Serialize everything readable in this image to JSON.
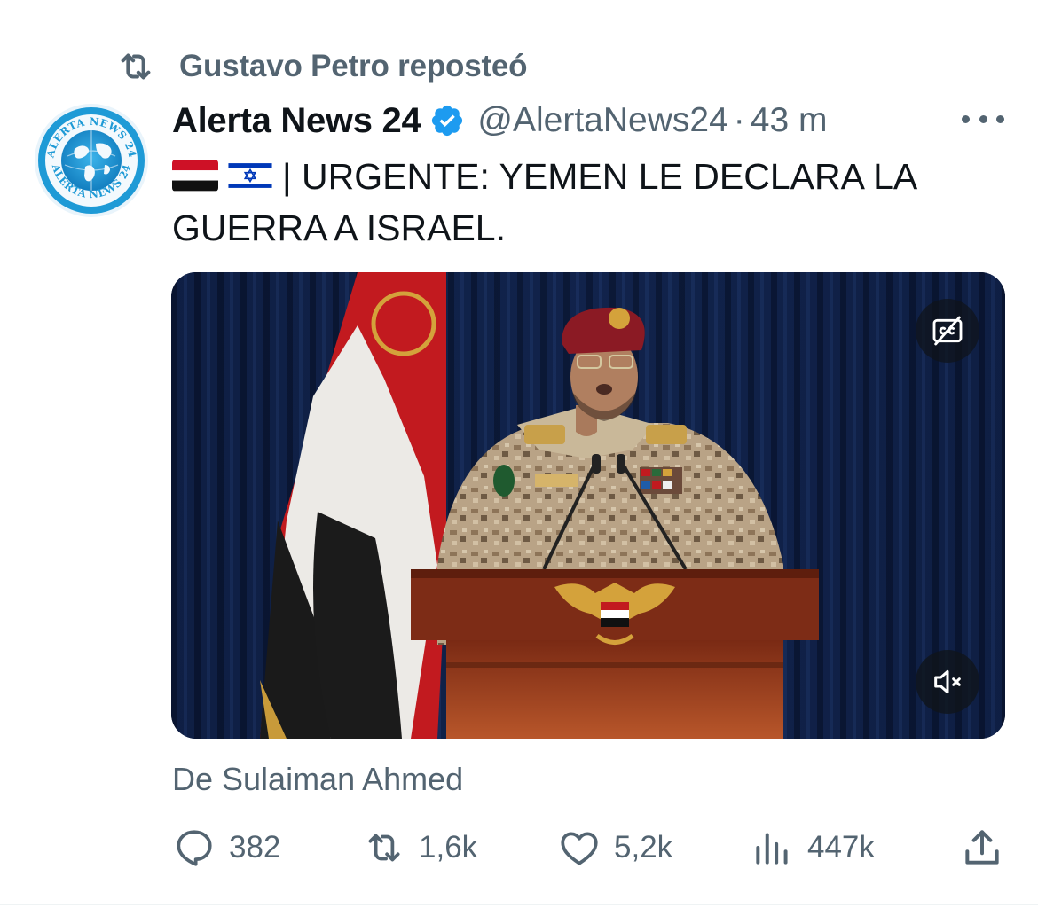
{
  "repost": {
    "icon": "repost-icon",
    "text": "Gustavo Petro reposteó"
  },
  "tweet": {
    "avatar": "alerta-news-24-logo",
    "avatar_text_top": "ALERTA NEWS 24",
    "avatar_text_bottom": "ALERTA NEWS 24",
    "display_name": "Alerta News 24",
    "verified_icon": "verified-badge-icon",
    "handle": "@AlertaNews24",
    "separator": "·",
    "time": "43 m",
    "more_icon": "more-icon",
    "flags": [
      "yemen-flag",
      "israel-flag"
    ],
    "text": "| URGENTE: YEMEN LE DECLARA LA GUERRA A ISRAEL.",
    "media": {
      "type": "video",
      "cc_icon": "captions-off-icon",
      "mute_icon": "muted-speaker-icon"
    },
    "attribution": "De Sulaiman Ahmed"
  },
  "actions": {
    "reply": {
      "icon": "reply-icon",
      "count": "382"
    },
    "retweet": {
      "icon": "retweet-icon",
      "count": "1,6k"
    },
    "like": {
      "icon": "heart-icon",
      "count": "5,2k"
    },
    "views": {
      "icon": "views-icon",
      "count": "447k"
    },
    "share": {
      "icon": "share-icon"
    }
  },
  "colors": {
    "text_primary": "#0f1419",
    "text_secondary": "#536471",
    "verified_blue": "#1d9bf0",
    "avatar_blue": "#1e9ad6"
  }
}
